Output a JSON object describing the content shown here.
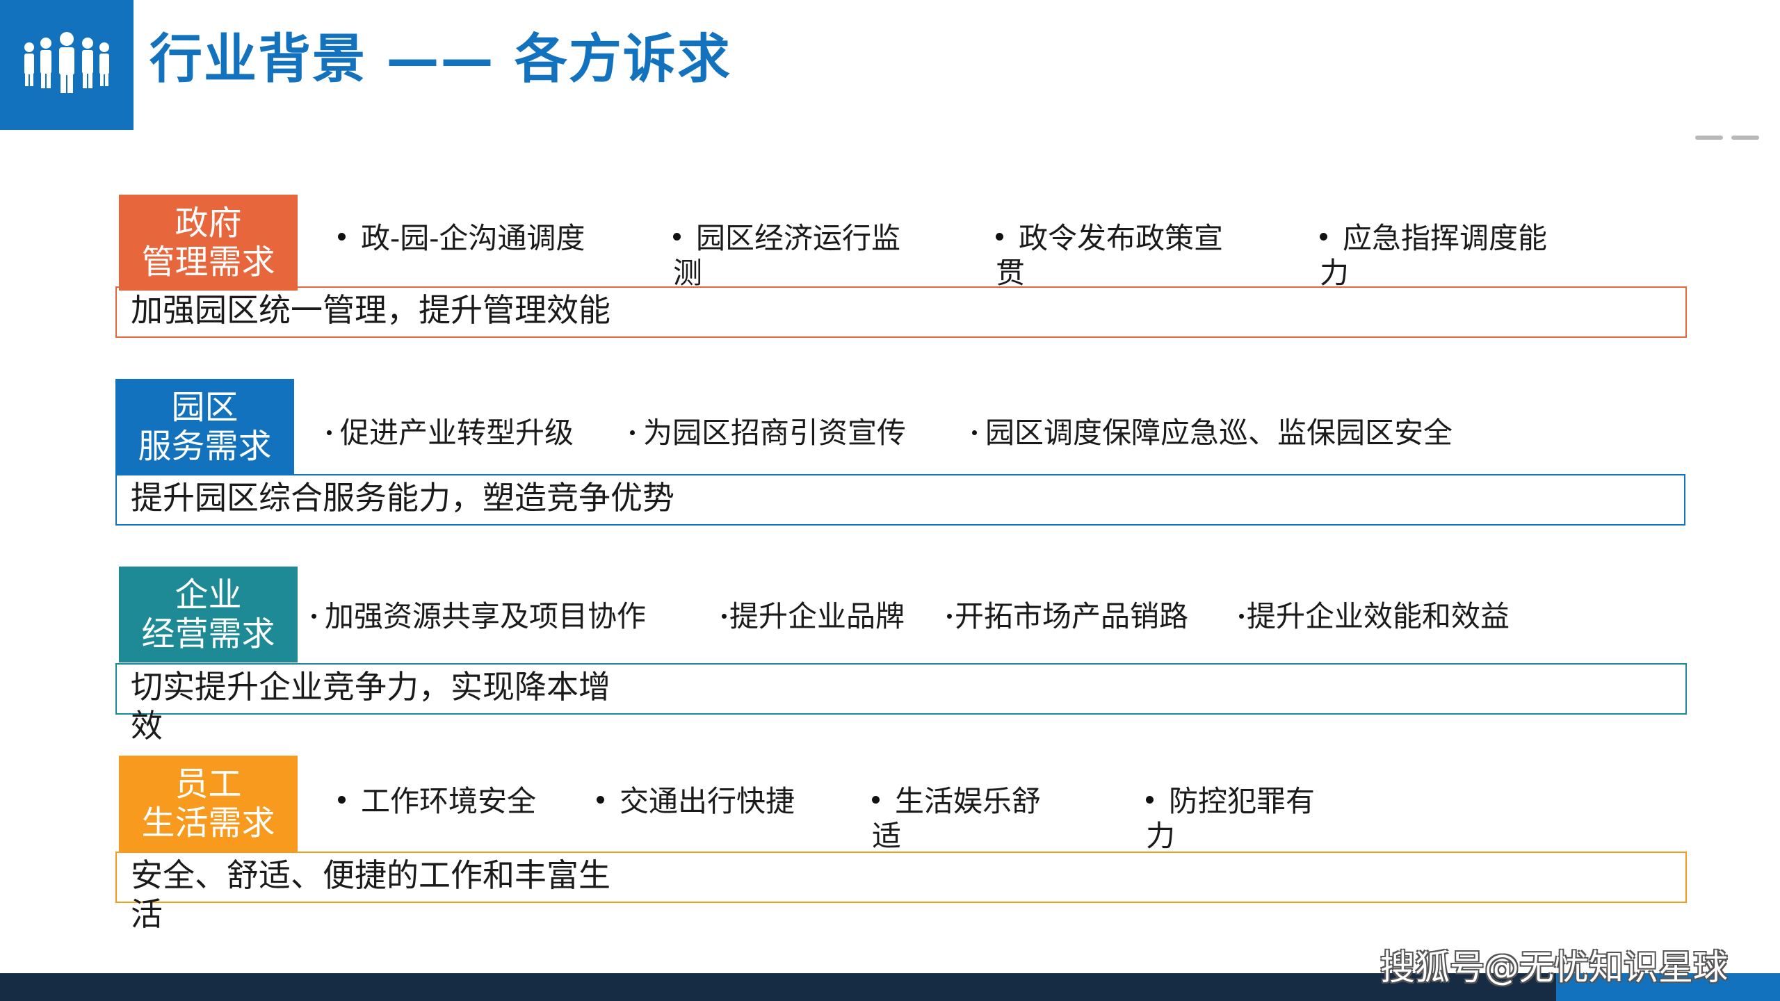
{
  "header": {
    "title": "行业背景 —— 各方诉求",
    "logo_icon": "people-group-icon",
    "logo_bg": "#1372be"
  },
  "sections": [
    {
      "label": [
        "政府",
        "管理需求"
      ],
      "color": "#e8663c",
      "border": "#e8663c",
      "items": [
        "政-园-企沟通调度",
        "园区经济运行监测",
        "政令发布政策宣贯",
        "应急指挥调度能力"
      ],
      "summary": "加强园区统一管理，提升管理效能"
    },
    {
      "label": [
        "园区",
        "服务需求"
      ],
      "color": "#1372be",
      "border": "#1372be",
      "items": [
        "促进产业转型升级",
        "为园区招商引资宣传",
        "园区调度保障应急巡、监保园区安全"
      ],
      "summary": "提升园区综合服务能力，塑造竞争优势"
    },
    {
      "label": [
        "企业",
        "经营需求"
      ],
      "color": "#1e8a96",
      "border": "#1e8a96",
      "items": [
        "加强资源共享及项目协作",
        "提升企业品牌",
        "开拓市场产品销路",
        "提升企业效能和效益"
      ],
      "summary": "切实提升企业竞争力，实现降本增效"
    },
    {
      "label": [
        "员工",
        "生活需求"
      ],
      "color": "#f79a1e",
      "border": "#f79a1e",
      "items": [
        "工作环境安全",
        "交通出行快捷",
        "生活娱乐舒适",
        "防控犯罪有力"
      ],
      "summary": "安全、舒适、便捷的工作和丰富生活"
    }
  ],
  "watermark": "搜狐号@无忧知识星球"
}
